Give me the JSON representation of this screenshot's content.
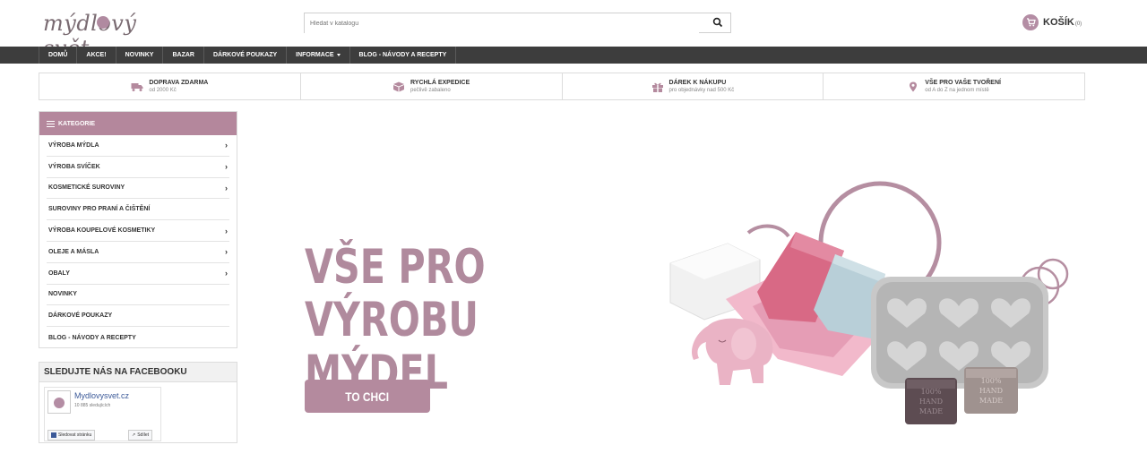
{
  "header": {
    "logo_text": "mýdlový svět",
    "search_placeholder": "Hledat v katalogu",
    "cart_label": "KOŠÍK",
    "cart_count": "(0)"
  },
  "nav": {
    "items": [
      "DOMŮ",
      "AKCE!",
      "NOVINKY",
      "BAZAR",
      "DÁRKOVÉ POUKAZY",
      "INFORMACE",
      "BLOG - NÁVODY A RECEPTY"
    ]
  },
  "benefits": [
    {
      "icon": "truck-icon",
      "title": "DOPRAVA ZDARMA",
      "subtitle": "od 2000 Kč"
    },
    {
      "icon": "box-icon",
      "title": "RYCHLÁ EXPEDICE",
      "subtitle": "pečlivě zabaleno"
    },
    {
      "icon": "gift-icon",
      "title": "DÁREK K NÁKUPU",
      "subtitle": "pro objednávky nad 500 Kč"
    },
    {
      "icon": "location-pin-icon",
      "title": "VŠE PRO VAŠE TVOŘENÍ",
      "subtitle": "od A do Z na jednom místě"
    }
  ],
  "sidebar": {
    "heading": "KATEGORIE",
    "items": [
      {
        "label": "VÝROBA MÝDLA",
        "chevron": "›"
      },
      {
        "label": "VÝROBA SVÍČEK",
        "chevron": "›"
      },
      {
        "label": "KOSMETICKÉ SUROVINY",
        "chevron": "›"
      },
      {
        "label": "SUROVINY PRO PRANÍ A ČIŠTĚNÍ",
        "chevron": ""
      },
      {
        "label": "VÝROBA KOUPELOVÉ KOSMETIKY",
        "chevron": "›"
      },
      {
        "label": "OLEJE A MÁSLA",
        "chevron": "›"
      },
      {
        "label": "OBALY",
        "chevron": "›"
      },
      {
        "label": "NOVINKY",
        "chevron": ""
      },
      {
        "label": "DÁRKOVÉ POUKAZY",
        "chevron": ""
      },
      {
        "label": "BLOG - NÁVODY A RECEPTY",
        "chevron": ""
      }
    ]
  },
  "facebook": {
    "heading": "SLEDUJTE NÁS NA FACEBOOKU",
    "page_name": "Mydlovysvet.cz",
    "followers": "10 885 sledujících",
    "follow_label": "Sledovat stránku",
    "share_label": "Sdílet"
  },
  "hero": {
    "title_line1": "VŠE PRO",
    "title_line2": "VÝROBU MÝDEL",
    "button_label": "TO CHCI",
    "stamp_text_1": "100%",
    "stamp_text_2": "HAND",
    "stamp_text_3": "MADE"
  },
  "colors": {
    "accent": "#b48a9e",
    "nav_bg": "#3d3d3d",
    "title": "#b08a9d"
  }
}
